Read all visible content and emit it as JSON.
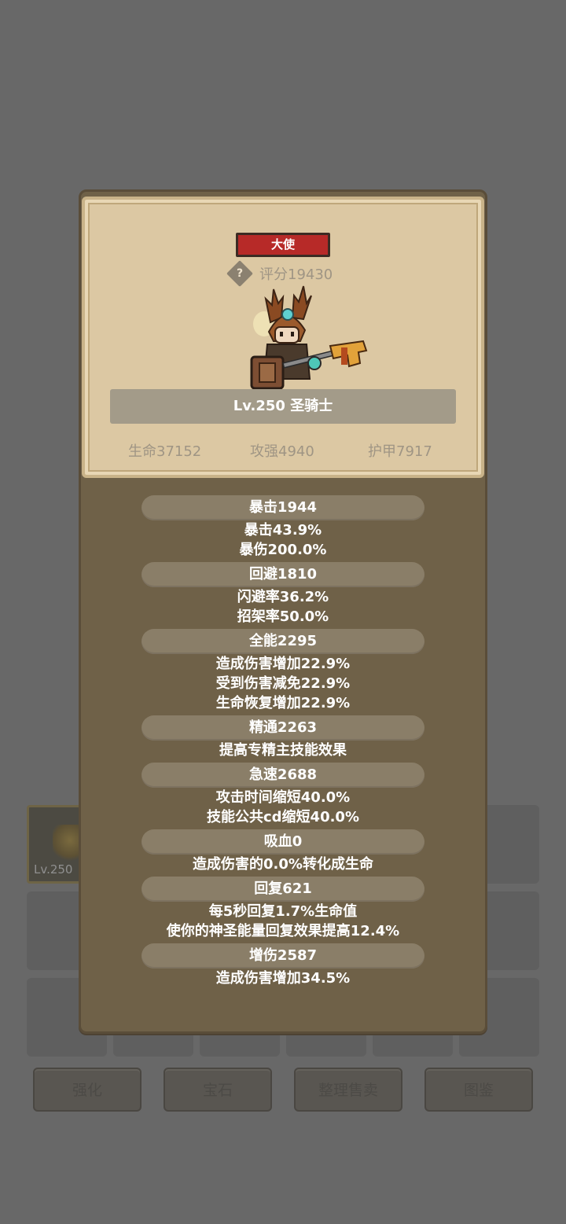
{
  "background": {
    "item_level": "Lv.250",
    "buttons": [
      "强化",
      "宝石",
      "整理售卖",
      "图鉴"
    ]
  },
  "card": {
    "rarity": "大使",
    "help_icon": "?",
    "score": "评分19430",
    "name": "Lv.250 圣骑士",
    "base_stats": [
      "生命37152",
      "攻强4940",
      "护甲7917"
    ]
  },
  "stats": [
    {
      "head": "暴击1944",
      "lines": [
        "暴击43.9%",
        "暴伤200.0%"
      ]
    },
    {
      "head": "回避1810",
      "lines": [
        "闪避率36.2%",
        "招架率50.0%"
      ]
    },
    {
      "head": "全能2295",
      "lines": [
        "造成伤害增加22.9%",
        "受到伤害减免22.9%",
        "生命恢复增加22.9%"
      ]
    },
    {
      "head": "精通2263",
      "lines": [
        "提高专精主技能效果"
      ]
    },
    {
      "head": "急速2688",
      "lines": [
        "攻击时间缩短40.0%",
        "技能公共cd缩短40.0%"
      ]
    },
    {
      "head": "吸血0",
      "lines": [
        "造成伤害的0.0%转化成生命"
      ]
    },
    {
      "head": "回复621",
      "lines": [
        "每5秒回复1.7%生命值",
        "使你的神圣能量回复效果提高12.4%"
      ]
    },
    {
      "head": "增伤2587",
      "lines": [
        "造成伤害增加34.5%"
      ]
    }
  ],
  "colors": {
    "rarity_red": "#b72a28",
    "panel_brown": "#6f6148",
    "card_parchment": "#dcc8a3"
  }
}
